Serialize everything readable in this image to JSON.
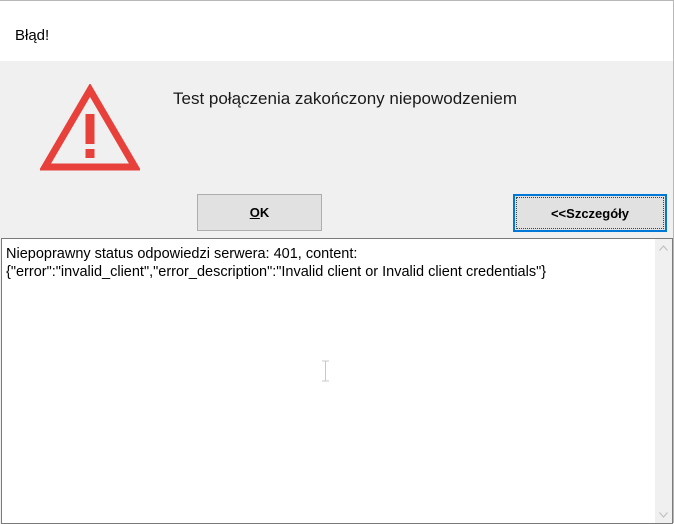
{
  "window": {
    "title": "Błąd!"
  },
  "dialog": {
    "message": "Test połączenia zakończony niepowodzeniem",
    "icon": "warning-triangle-icon",
    "icon_color": "#e8403a"
  },
  "buttons": {
    "ok_label": "OK",
    "details_label": "<<Szczegóły"
  },
  "details": {
    "text": "Niepoprawny status odpowiedzi serwera: 401, content:\n{\"error\":\"invalid_client\",\"error_description\":\"Invalid client or Invalid client credentials\"}"
  },
  "colors": {
    "accent": "#0078d7",
    "client_bg": "#f0f0f0"
  }
}
